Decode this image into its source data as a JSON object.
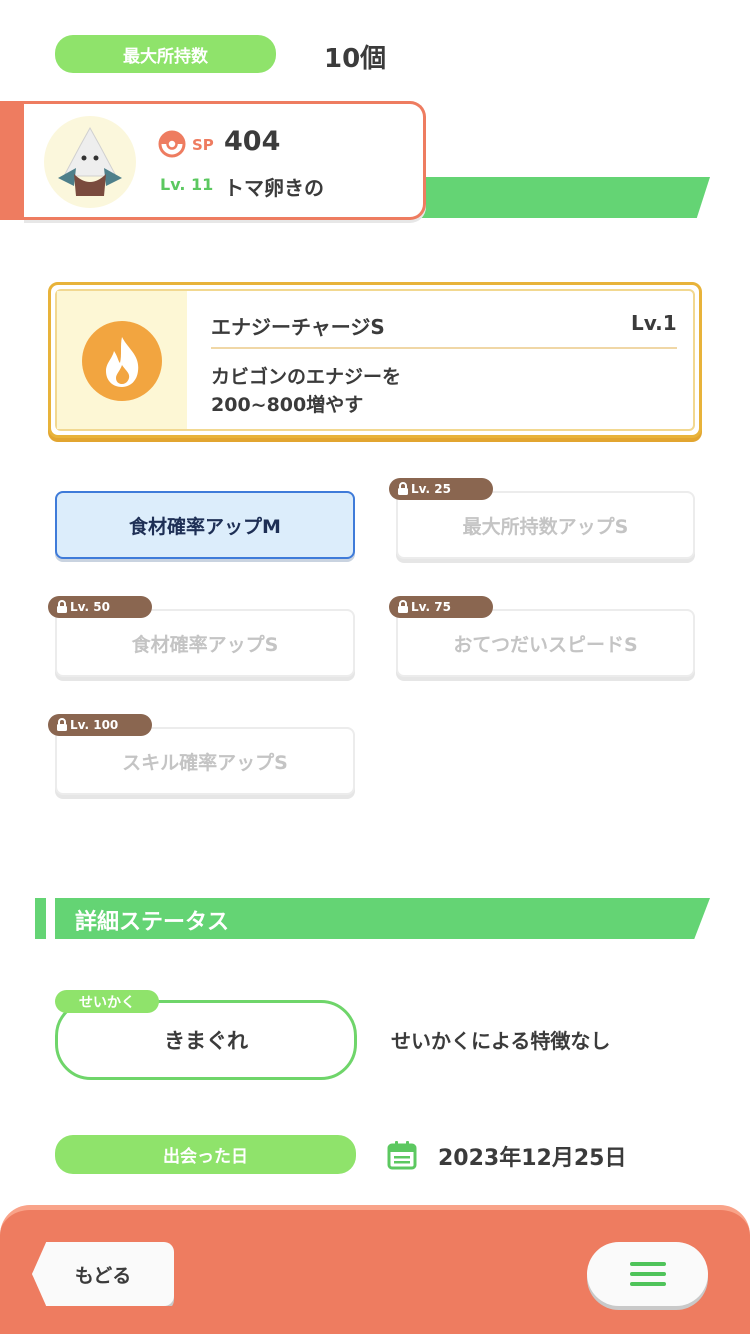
{
  "colors": {
    "accent_green": "#64d474",
    "pill_green": "#8fe36b",
    "coral": "#ee7c60",
    "skill_gold": "#e8b33a",
    "active_blue": "#3f7bd9",
    "lock_brown": "#8a6650"
  },
  "carry": {
    "label": "最大所持数",
    "value": "10個"
  },
  "pokemon": {
    "avatar_icon": "pokemon-portrait-icon",
    "sp_icon": "pokeball-icon",
    "sp_label": "SP",
    "sp_value": "404",
    "level_label": "Lv. 11",
    "name": "トマ卵きの"
  },
  "main_skill": {
    "icon": "flame-icon",
    "name": "エナジーチャージS",
    "level": "Lv.1",
    "description_line1": "カビゴンのエナジーを",
    "description_line2": "200~800増やす"
  },
  "sub_skills": [
    {
      "label": "食材確率アップM",
      "locked": false,
      "unlock_level": ""
    },
    {
      "label": "最大所持数アップS",
      "locked": true,
      "unlock_level": "Lv. 25"
    },
    {
      "label": "食材確率アップS",
      "locked": true,
      "unlock_level": "Lv. 50"
    },
    {
      "label": "おてつだいスピードS",
      "locked": true,
      "unlock_level": "Lv. 75"
    },
    {
      "label": "スキル確率アップS",
      "locked": true,
      "unlock_level": "Lv. 100"
    }
  ],
  "details": {
    "section_title": "詳細ステータス",
    "nature_tag": "せいかく",
    "nature_value": "きまぐれ",
    "nature_effect": "せいかくによる特徴なし",
    "met_label": "出会った日",
    "met_icon": "calendar-icon",
    "met_date": "2023年12月25日"
  },
  "footer": {
    "back_label": "もどる",
    "menu_icon": "hamburger-menu-icon"
  }
}
